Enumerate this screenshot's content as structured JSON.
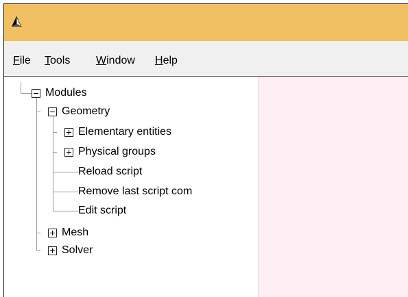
{
  "menu": {
    "file": {
      "mnemonic": "F",
      "rest": "ile"
    },
    "tools": {
      "mnemonic": "T",
      "rest": "ools"
    },
    "window": {
      "mnemonic": "W",
      "rest": "indow"
    },
    "help": {
      "mnemonic": "H",
      "rest": "elp"
    }
  },
  "tree": {
    "modules": {
      "label": "Modules",
      "state": "expanded"
    },
    "geometry": {
      "label": "Geometry",
      "state": "expanded"
    },
    "elementary_entities": {
      "label": "Elementary entities",
      "state": "collapsed"
    },
    "physical_groups": {
      "label": "Physical groups",
      "state": "collapsed"
    },
    "reload_script": {
      "label": "Reload script"
    },
    "remove_last_script_command": {
      "label": "Remove last script com"
    },
    "edit_script": {
      "label": "Edit script"
    },
    "mesh": {
      "label": "Mesh",
      "state": "collapsed"
    },
    "solver": {
      "label": "Solver",
      "state": "collapsed"
    }
  },
  "colors": {
    "titlebar": "#f0c062",
    "menubar": "#f0f0f0",
    "viewer_background": "#fdeff3"
  },
  "icons": {
    "app": "gmsh-logo-icon",
    "expanded": "minus-box-icon",
    "collapsed": "plus-box-icon"
  }
}
